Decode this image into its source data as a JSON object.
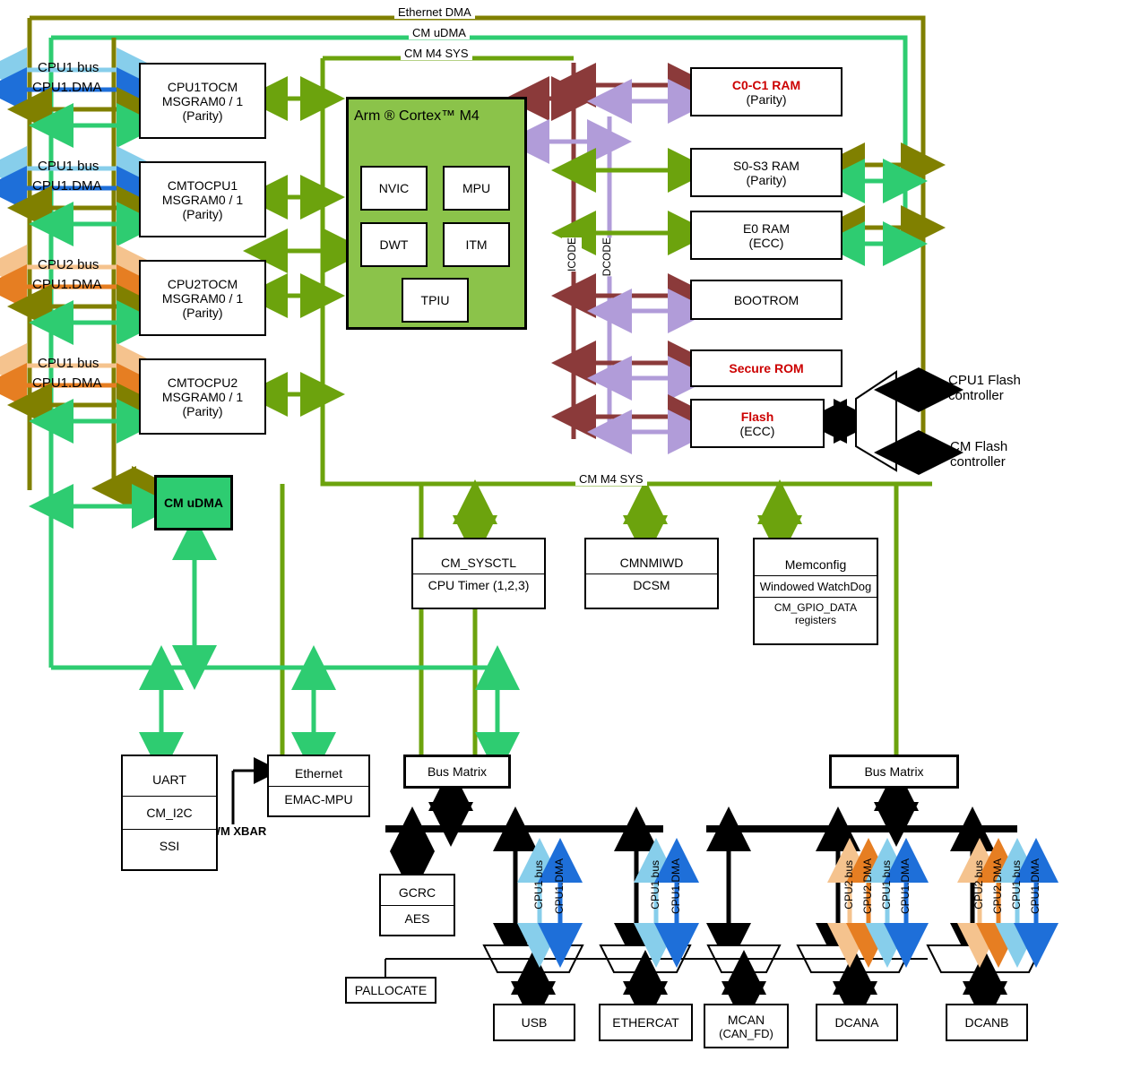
{
  "buses": {
    "ethernet_dma": "Ethernet DMA",
    "cm_udma": "CM uDMA",
    "cm_m4_sys": "CM M4 SYS",
    "icode": "ICODE",
    "dcode": "DCODE"
  },
  "ext_labels": {
    "cpu1_bus": "CPU1 bus",
    "cpu1_dma": "CPU1.DMA",
    "cpu2_bus": "CPU2 bus",
    "cpu2_dma": "CPU2.DMA",
    "cpu1_flash": "CPU1 Flash controller",
    "cm_flash": "CM Flash controller",
    "pwm_xbar": "PWM XBAR"
  },
  "msgrams": [
    {
      "name": "CPU1TOCM",
      "line2": "MSGRAM0 / 1",
      "parity": "(Parity)"
    },
    {
      "name": "CMTOCPU1",
      "line2": "MSGRAM0 / 1",
      "parity": "(Parity)"
    },
    {
      "name": "CPU2TOCM",
      "line2": "MSGRAM0 / 1",
      "parity": "(Parity)"
    },
    {
      "name": "CMTOCPU2",
      "line2": "MSGRAM0 / 1",
      "parity": "(Parity)"
    }
  ],
  "cortex": {
    "title": "Arm ® Cortex™ M4",
    "blocks": {
      "nvic": "NVIC",
      "mpu": "MPU",
      "dwt": "DWT",
      "itm": "ITM",
      "tpiu": "TPIU"
    }
  },
  "memories": {
    "c0c1": {
      "title": "C0-C1 RAM",
      "sub": "(Parity)"
    },
    "s0s3": {
      "title": "S0-S3 RAM",
      "sub": "(Parity)"
    },
    "e0": {
      "title": "E0 RAM",
      "sub": "(ECC)"
    },
    "bootrom": {
      "title": "BOOTROM"
    },
    "securerom": {
      "title": "Secure ROM"
    },
    "flash": {
      "title": "Flash",
      "sub": "(ECC)"
    }
  },
  "cm_udma_block": "CM uDMA",
  "sys_blocks": {
    "cm_sysctl": {
      "r1": "CM_SYSCTL",
      "r2": "CPU Timer (1,2,3)"
    },
    "cmnmiwd": {
      "r1": "CMNMIWD",
      "r2": "DCSM"
    },
    "memconfig": {
      "r1": "Memconfig",
      "r2": "Windowed WatchDog",
      "r3": "CM_GPIO_DATA registers"
    }
  },
  "comm_stack": {
    "uart": "UART",
    "i2c": "CM_I2C",
    "ssi": "SSI"
  },
  "eth_stack": {
    "ethernet": "Ethernet",
    "emac": "EMAC-MPU"
  },
  "bus_matrix": "Bus Matrix",
  "gcrc_aes": {
    "r1": "GCRC",
    "r2": "AES"
  },
  "pallocate": "PALLOCATE",
  "bottom": {
    "usb": "USB",
    "ethercat": "ETHERCAT",
    "mcan": "MCAN",
    "mcan_sub": "(CAN_FD)",
    "dcana": "DCANA",
    "dcanb": "DCANB"
  }
}
